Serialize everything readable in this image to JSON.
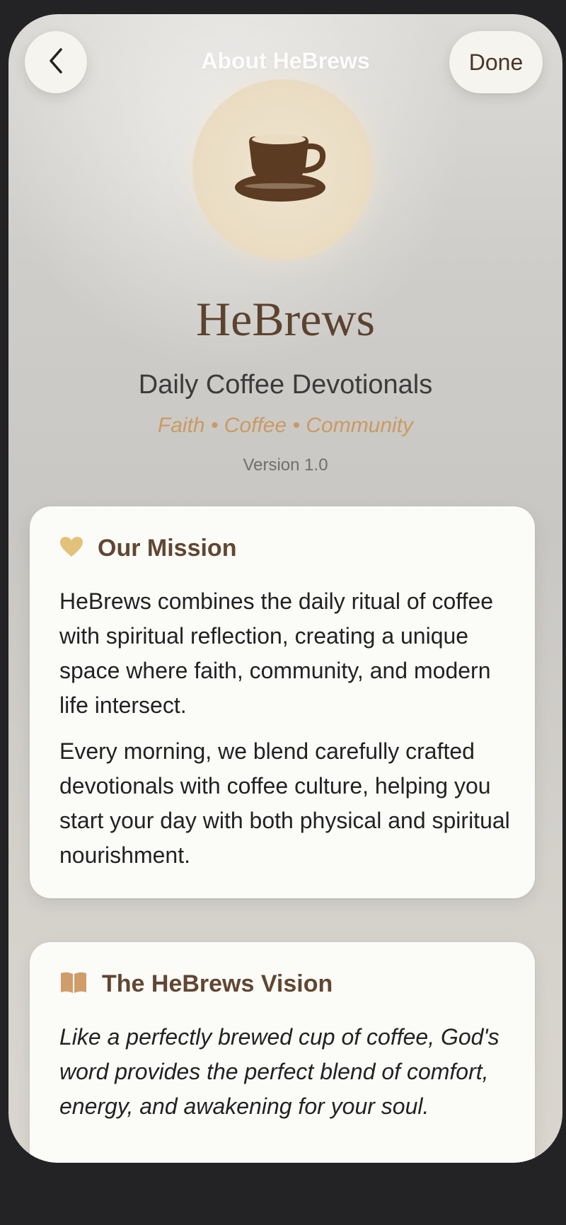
{
  "nav": {
    "title": "About HeBrews",
    "done_label": "Done",
    "back_icon": "chevron-left-icon"
  },
  "header": {
    "logo_icon": "coffee-cup-icon",
    "app_name": "HeBrews",
    "subtitle": "Daily Coffee Devotionals",
    "tagline": "Faith • Coffee • Community",
    "version": "Version 1.0"
  },
  "mission": {
    "icon": "heart-icon",
    "title": "Our Mission",
    "paragraphs": [
      "HeBrews combines the daily ritual of coffee with spiritual reflection, creating a unique space where faith, community, and modern life intersect.",
      "Every morning, we blend carefully crafted devotionals with coffee culture, helping you start your day with both physical and spiritual nourishment."
    ]
  },
  "vision": {
    "icon": "book-icon",
    "title": "The HeBrews Vision",
    "text": "Like a perfectly brewed cup of coffee, God's word provides the perfect blend of comfort, energy, and awakening for your soul."
  },
  "colors": {
    "accent_brown": "#5b432f",
    "accent_gold": "#c99a64",
    "heart_gold": "#e2c27a",
    "book_tan": "#cf9c6a"
  }
}
